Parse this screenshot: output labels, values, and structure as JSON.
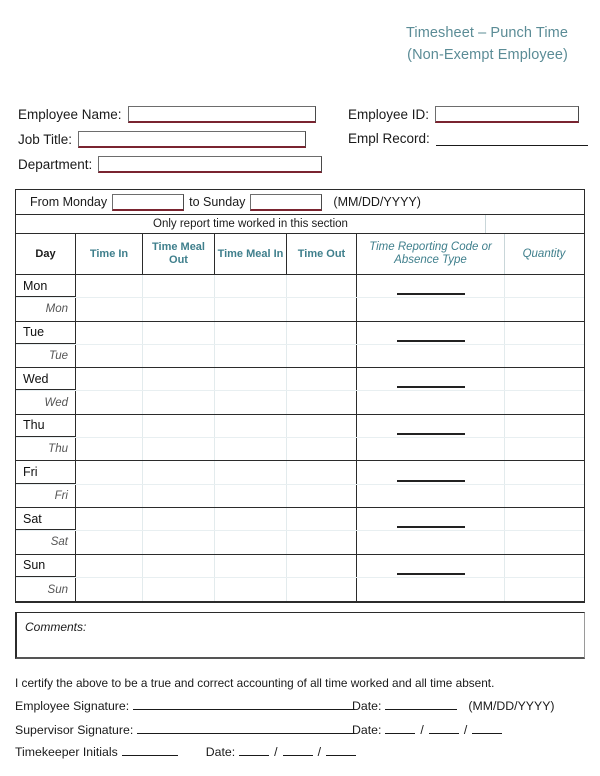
{
  "title": {
    "line1": "Timesheet – Punch Time",
    "line2": "(Non-Exempt Employee)",
    "color": "#5b8c96"
  },
  "employee_info": {
    "name_label": "Employee Name:",
    "name_value": "",
    "job_title_label": "Job Title:",
    "job_title_value": "",
    "department_label": "Department:",
    "department_value": "",
    "employee_id_label": "Employee ID:",
    "employee_id_value": "",
    "empl_record_label": "Empl Record:",
    "empl_record_value": ""
  },
  "week_range": {
    "from_label": "From Monday",
    "from_value": "",
    "to_label": "to Sunday",
    "to_value": "",
    "format_hint": "(MM/DD/YYYY)"
  },
  "table": {
    "banner": "Only report time worked in this section",
    "headers": {
      "day": "Day",
      "time_in": "Time In",
      "time_meal_out": "Time Meal Out",
      "time_meal_in": "Time Meal In",
      "time_out": "Time Out",
      "code": "Time Reporting Code or Absence Type",
      "quantity": "Quantity"
    },
    "header_color_teal": "#3f7f8c",
    "rows": [
      {
        "day": "Mon",
        "sub": "Mon",
        "time_in": "",
        "time_meal_out": "",
        "time_meal_in": "",
        "time_out": "",
        "code": "",
        "quantity": ""
      },
      {
        "day": "Tue",
        "sub": "Tue",
        "time_in": "",
        "time_meal_out": "",
        "time_meal_in": "",
        "time_out": "",
        "code": "",
        "quantity": ""
      },
      {
        "day": "Wed",
        "sub": "Wed",
        "time_in": "",
        "time_meal_out": "",
        "time_meal_in": "",
        "time_out": "",
        "code": "",
        "quantity": ""
      },
      {
        "day": "Thu",
        "sub": "Thu",
        "time_in": "",
        "time_meal_out": "",
        "time_meal_in": "",
        "time_out": "",
        "code": "",
        "quantity": ""
      },
      {
        "day": "Fri",
        "sub": "Fri",
        "time_in": "",
        "time_meal_out": "",
        "time_meal_in": "",
        "time_out": "",
        "code": "",
        "quantity": ""
      },
      {
        "day": "Sat",
        "sub": "Sat",
        "time_in": "",
        "time_meal_out": "",
        "time_meal_in": "",
        "time_out": "",
        "code": "",
        "quantity": ""
      },
      {
        "day": "Sun",
        "sub": "Sun",
        "time_in": "",
        "time_meal_out": "",
        "time_meal_in": "",
        "time_out": "",
        "code": "",
        "quantity": ""
      }
    ]
  },
  "comments": {
    "label": "Comments:",
    "value": ""
  },
  "certification": {
    "text": "I certify the above to be a true and correct accounting of all time worked and all time absent."
  },
  "signatures": {
    "employee_label": "Employee Signature:",
    "employee_value": "",
    "employee_date_label": "Date:",
    "employee_date_value": "",
    "employee_date_format": "(MM/DD/YYYY)",
    "supervisor_label": "Supervisor Signature:",
    "supervisor_value": "",
    "supervisor_date_label": "Date:",
    "supervisor_date_mm": "",
    "supervisor_date_dd": "",
    "supervisor_date_yy": "",
    "timekeeper_label": "Timekeeper Initials",
    "timekeeper_value": "",
    "timekeeper_date_label": "Date:",
    "timekeeper_date_mm": "",
    "timekeeper_date_dd": "",
    "timekeeper_date_yy": "",
    "slash": "/"
  }
}
